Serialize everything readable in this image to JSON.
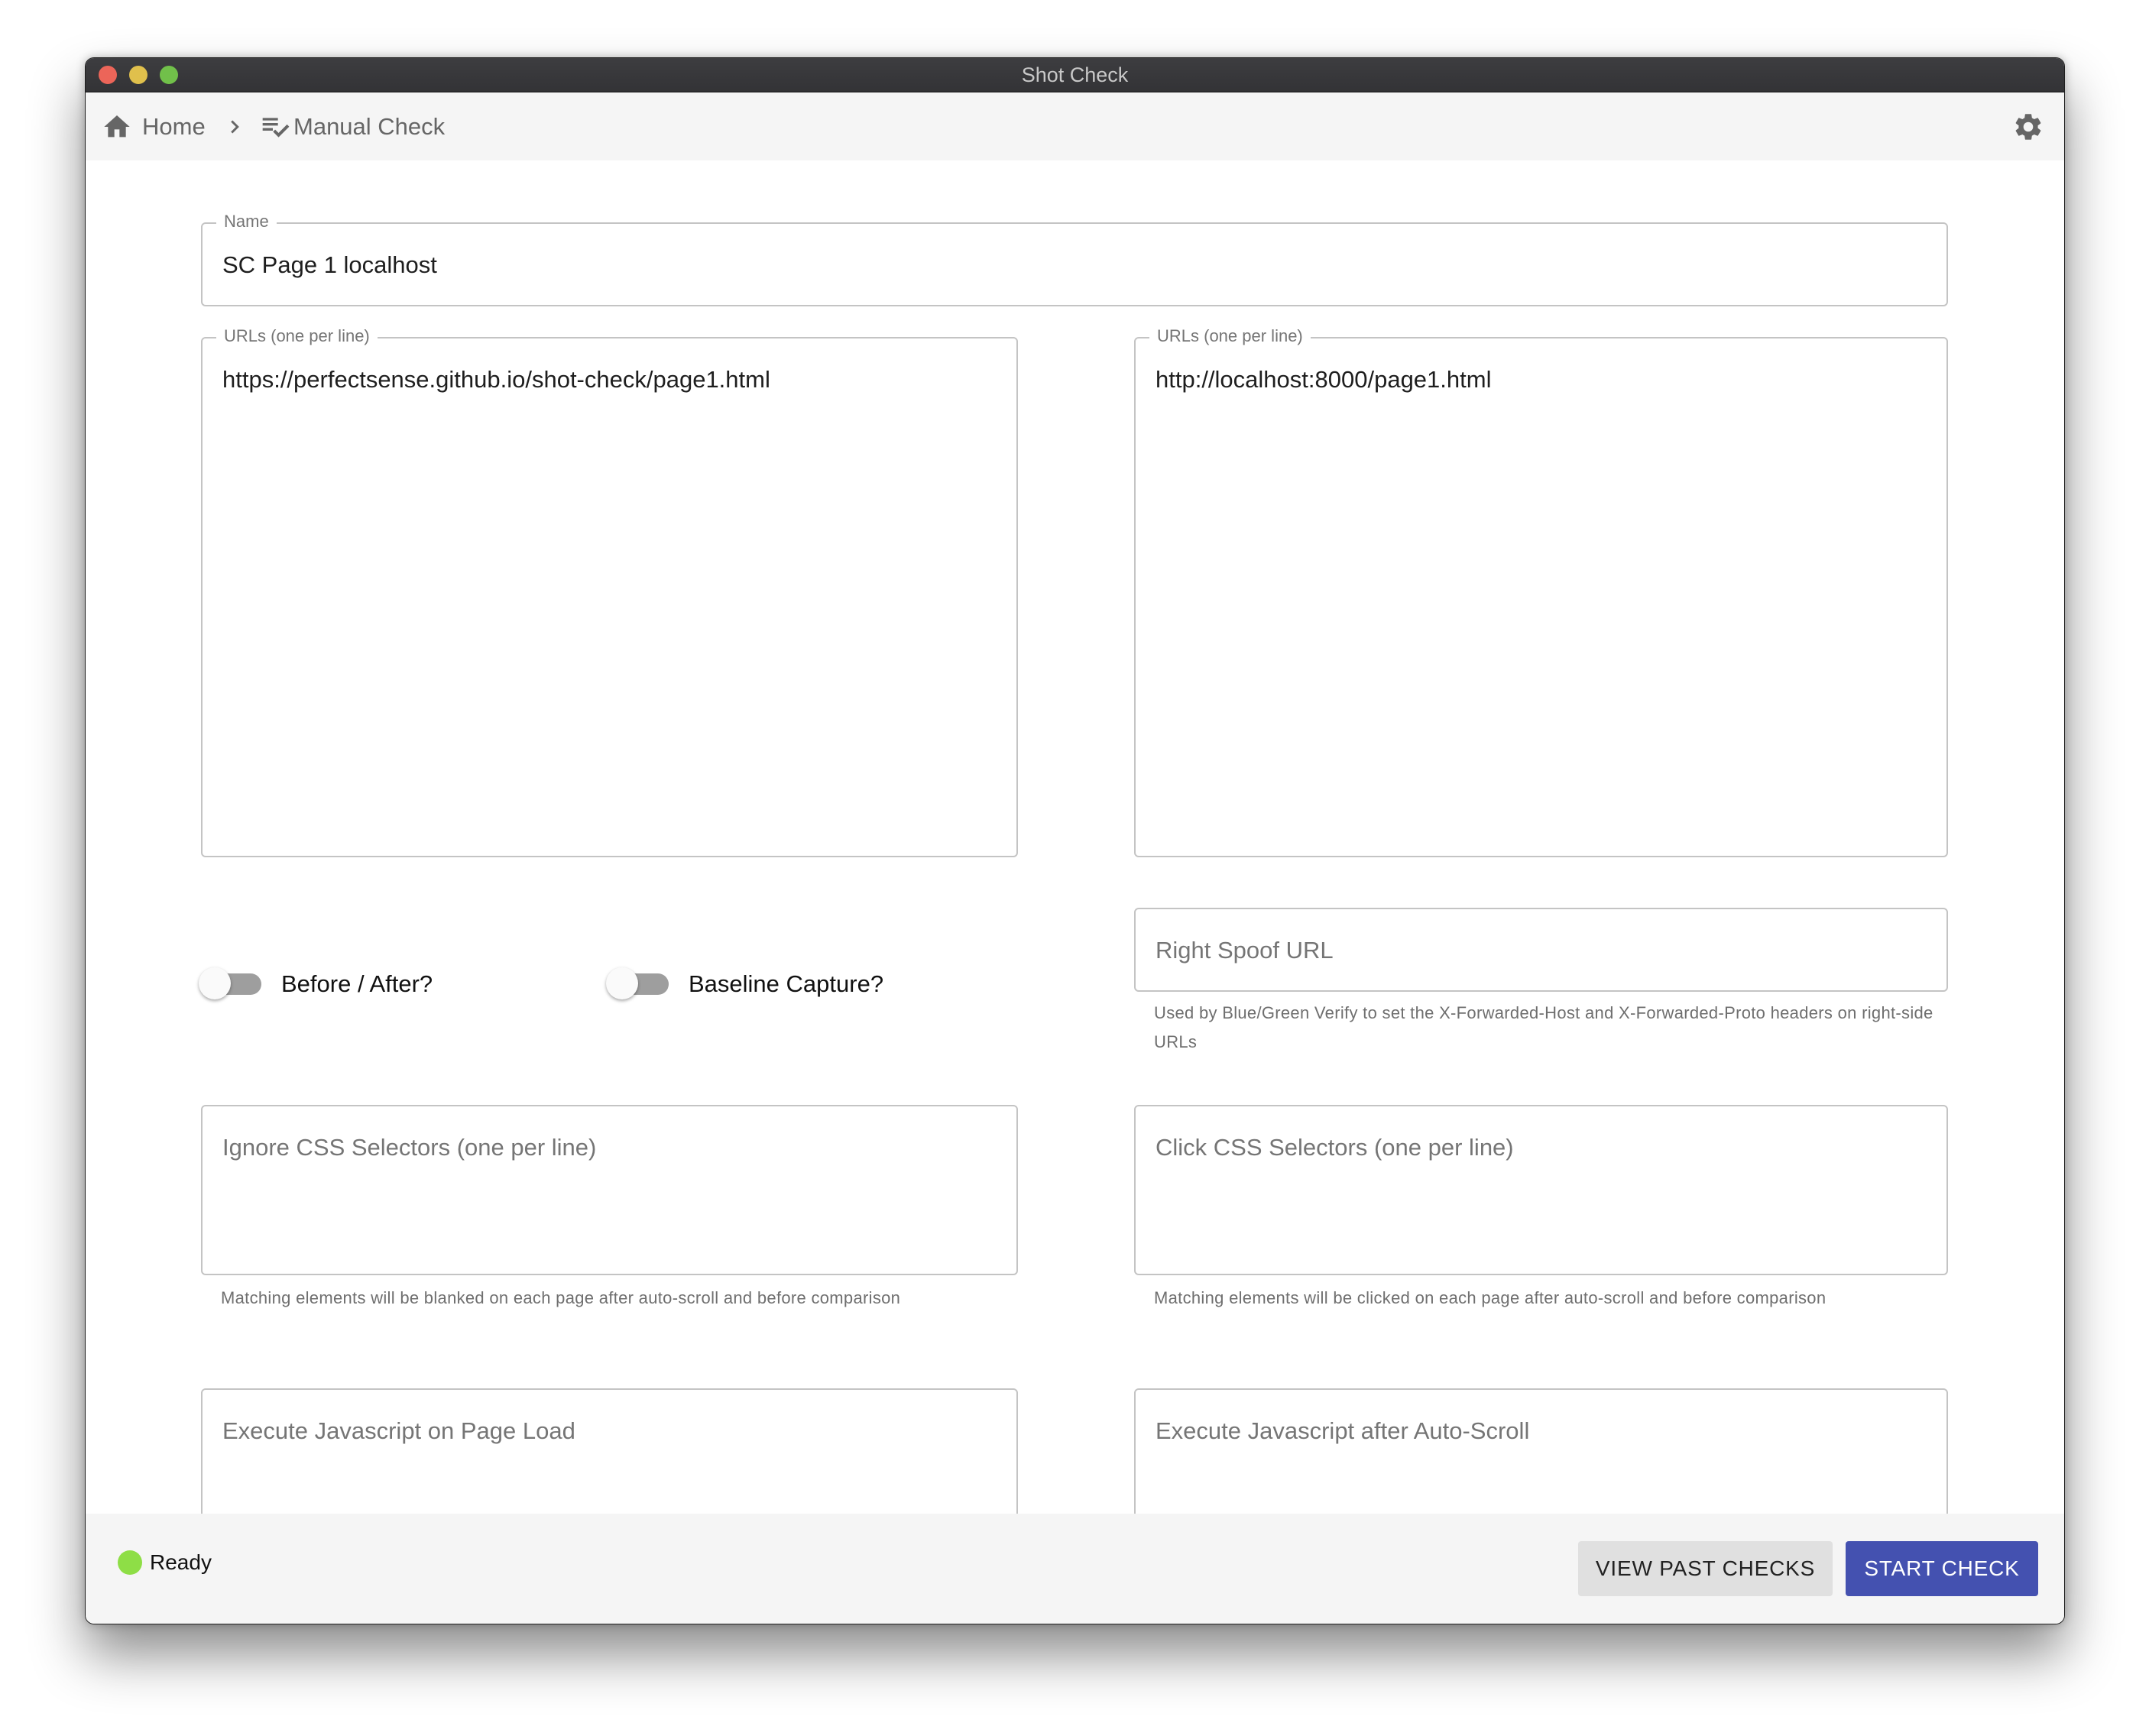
{
  "window": {
    "title": "Shot Check",
    "traffic_lights": [
      "close",
      "minimize",
      "zoom"
    ]
  },
  "toolbar": {
    "breadcrumb": [
      {
        "label": "Home",
        "icon": "home-icon"
      },
      {
        "label": "Manual Check",
        "icon": "playlist-check-icon"
      }
    ],
    "separator_icon": "chevron-right-icon",
    "settings_icon": "gear-icon"
  },
  "form": {
    "name": {
      "label": "Name",
      "value": "SC Page 1 localhost"
    },
    "left_urls": {
      "label": "URLs (one per line)",
      "value": "https://perfectsense.github.io/shot-check/page1.html"
    },
    "right_urls": {
      "label": "URLs (one per line)",
      "value": "http://localhost:8000/page1.html"
    },
    "before_after": {
      "label": "Before / After?",
      "checked": false
    },
    "baseline_capture": {
      "label": "Baseline Capture?",
      "checked": false
    },
    "right_spoof_url": {
      "placeholder": "Right Spoof URL",
      "value": "",
      "helper": "Used by Blue/Green Verify to set the X-Forwarded-Host and X-Forwarded-Proto headers on right-side URLs"
    },
    "ignore_css": {
      "placeholder": "Ignore CSS Selectors (one per line)",
      "value": "",
      "helper": "Matching elements will be blanked on each page after auto-scroll and before comparison"
    },
    "click_css": {
      "placeholder": "Click CSS Selectors (one per line)",
      "value": "",
      "helper": "Matching elements will be clicked on each page after auto-scroll and before comparison"
    },
    "js_page_load": {
      "placeholder": "Execute Javascript on Page Load",
      "value": ""
    },
    "js_after_scroll": {
      "placeholder": "Execute Javascript after Auto-Scroll",
      "value": ""
    }
  },
  "footer": {
    "status": {
      "text": "Ready",
      "color": "#8ede46"
    },
    "view_past_checks_label": "VIEW PAST CHECKS",
    "start_check_label": "START CHECK"
  },
  "colors": {
    "primary": "#4451b0",
    "secondary_button": "#e0e0e0",
    "toolbar_bg": "#f5f5f5",
    "titlebar_bg": "#3a3a3d"
  }
}
